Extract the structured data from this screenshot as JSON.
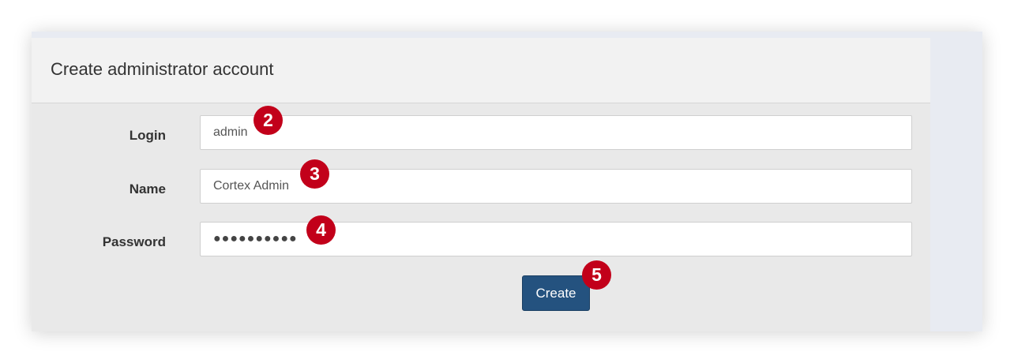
{
  "panel": {
    "title": "Create administrator account"
  },
  "form": {
    "login": {
      "label": "Login",
      "value": "admin"
    },
    "name": {
      "label": "Name",
      "value": "Cortex Admin"
    },
    "password": {
      "label": "Password",
      "value": "●●●●●●●●●●"
    },
    "submit_label": "Create"
  },
  "annotations": {
    "login": "2",
    "name": "3",
    "password": "4",
    "submit": "5"
  },
  "colors": {
    "button": "#24527f",
    "badge": "#c2001a",
    "panel_background": "#e9e9e9",
    "header_background": "#f2f2f2"
  }
}
